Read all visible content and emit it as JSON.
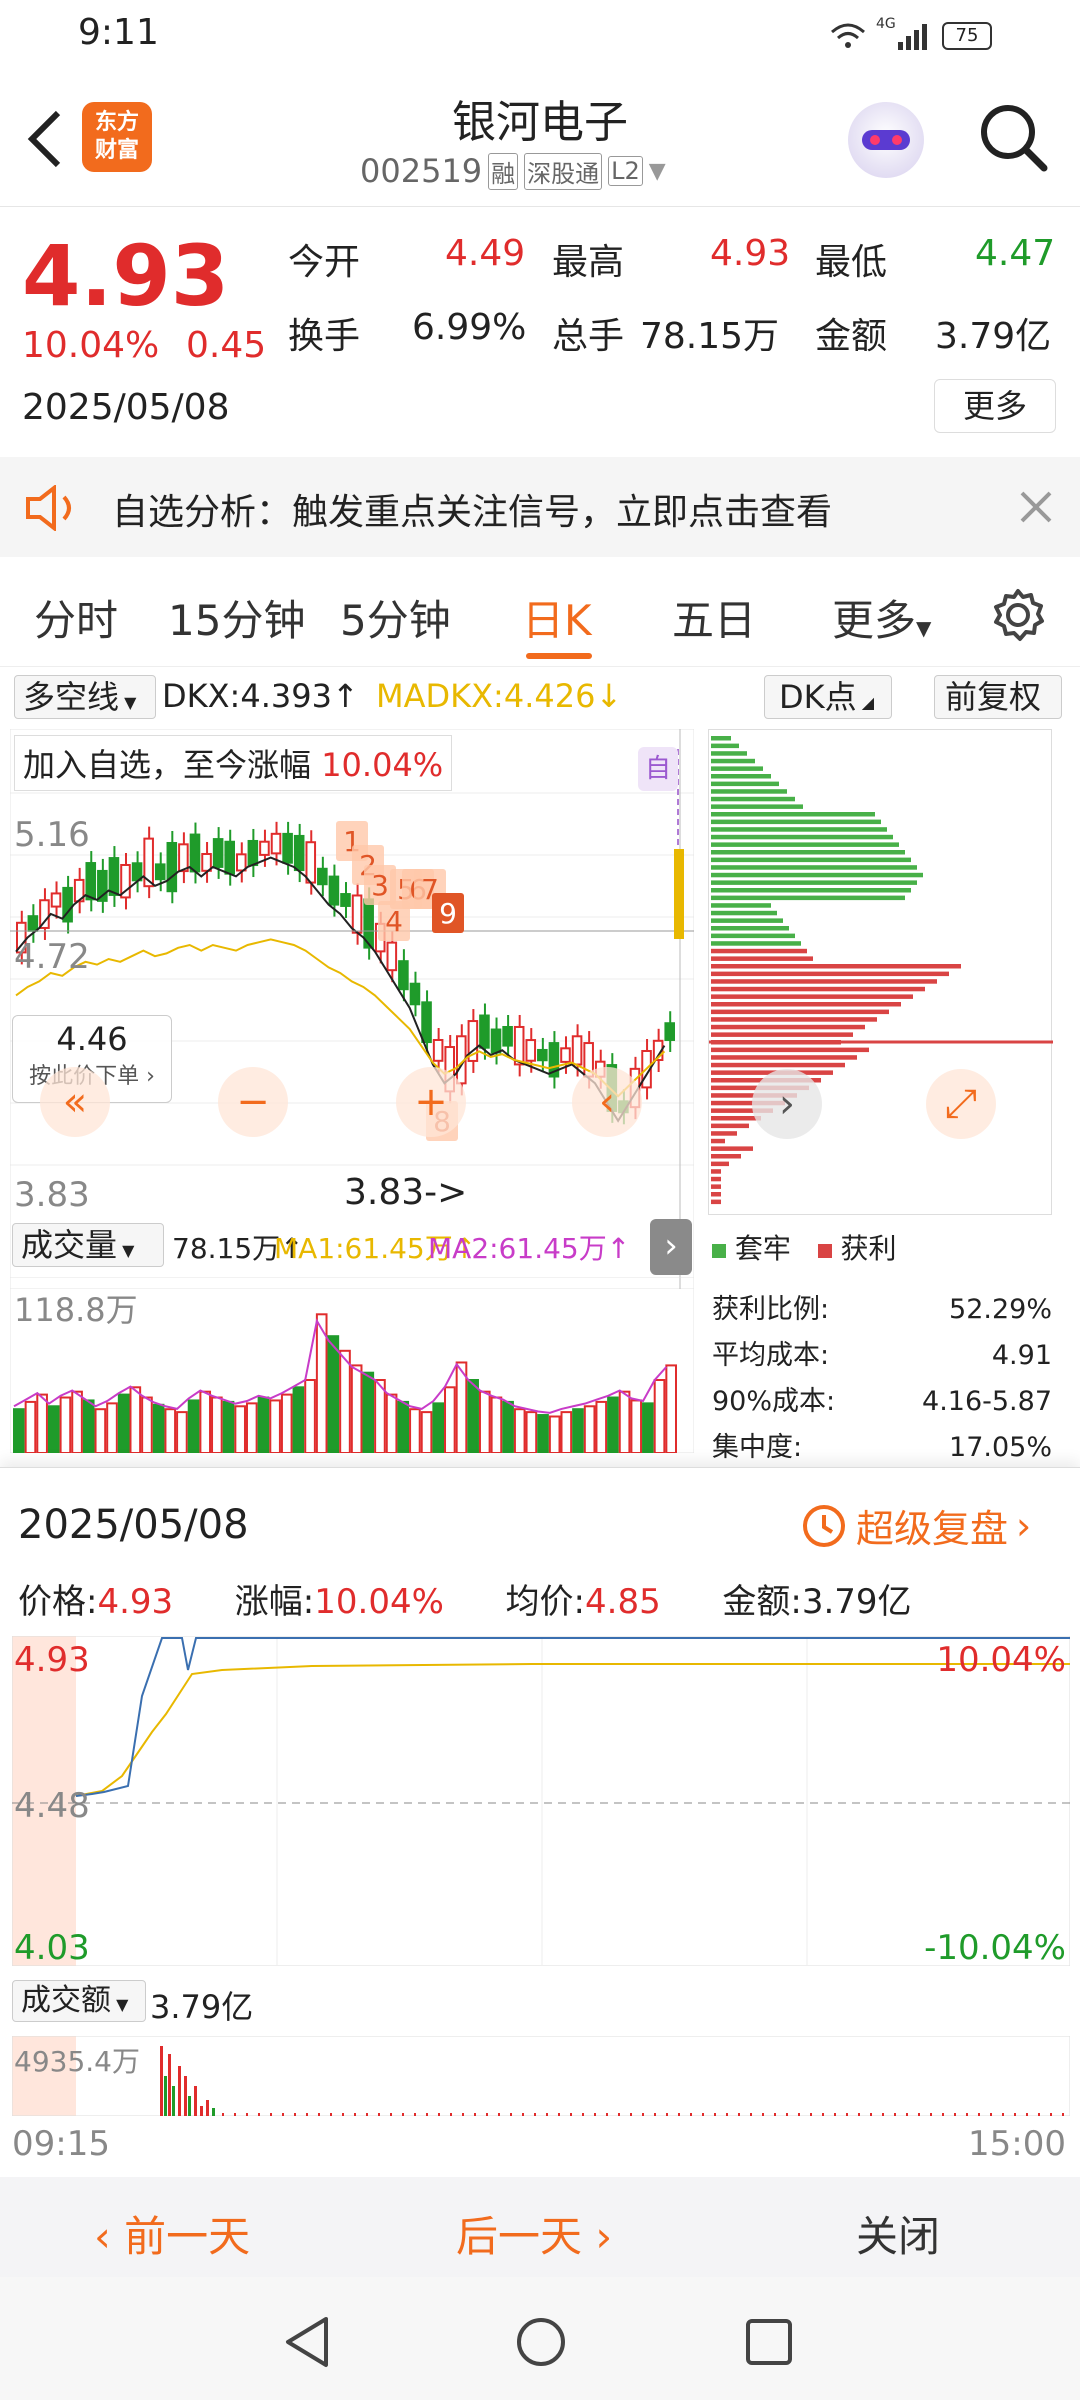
{
  "status_bar": {
    "time": "9:11",
    "signal_label": "4G",
    "battery": "75"
  },
  "header": {
    "back_icon": "chevron-left-icon",
    "logo_text_line1": "东方",
    "logo_text_line2": "财富",
    "stock_name": "银河电子",
    "stock_code": "002519",
    "tags": [
      "融",
      "深股通",
      "L2"
    ],
    "avatar_icon": "robot-avatar-icon",
    "search_icon": "search-icon"
  },
  "quote": {
    "price": "4.93",
    "change_pct": "10.04%",
    "change_amt": "0.45",
    "date": "2025/05/08",
    "open_label": "今开",
    "open_val": "4.49",
    "high_label": "最高",
    "high_val": "4.93",
    "low_label": "最低",
    "low_val": "4.47",
    "turnover_label": "换手",
    "turnover_val": "6.99%",
    "volume_label": "总手",
    "volume_val": "78.15万",
    "amount_label": "金额",
    "amount_val": "3.79亿",
    "more_button": "更多"
  },
  "notice": {
    "text": "自选分析：触发重点关注信号，立即点击查看"
  },
  "tabs": {
    "items": [
      "分时",
      "15分钟",
      "5分钟",
      "日K",
      "五日",
      "更多"
    ],
    "active": "日K"
  },
  "kchart": {
    "indicator_select": "多空线",
    "dkx_label": "DKX:4.393↑",
    "madkx_label": "MADKX:4.426↓",
    "dk_button": "DK点",
    "fq_button": "前复权",
    "added_text": "加入自选，至今涨幅",
    "added_pct": "10.04%",
    "price_labels": [
      "5.16",
      "4.72",
      "3.83"
    ],
    "cursor_price": "4.46",
    "cursor_order_text": "按此价下单",
    "low_marker": "3.83->",
    "signal_numbers": [
      "1",
      "2",
      "3",
      "4",
      "5",
      "6",
      "7",
      "8",
      "9"
    ],
    "self_tag": "自",
    "legend_trapped": "套牢",
    "legend_profit": "获利",
    "chips": {
      "profit_ratio_label": "获利比例:",
      "profit_ratio": "52.29%",
      "avg_cost_label": "平均成本:",
      "avg_cost": "4.91",
      "cost90_label": "90%成本:",
      "cost90": "4.16-5.87",
      "concentration_label": "集中度:",
      "concentration": "17.05%"
    },
    "volume_select": "成交量",
    "volume_val": "78.15万↑",
    "ma1": "MA1:61.45万↑",
    "ma2": "MA2:61.45万↑",
    "volume_max": "118.8万"
  },
  "popup": {
    "date": "2025/05/08",
    "replay_text": "超级复盘",
    "price_label": "价格:",
    "price_val": "4.93",
    "pct_label": "涨幅:",
    "pct_val": "10.04%",
    "avg_label": "均价:",
    "avg_val": "4.85",
    "amount_label": "金额:",
    "amount_val": "3.79亿",
    "y_top": "4.93",
    "y_mid": "4.48",
    "y_bottom": "4.03",
    "pct_top": "10.04%",
    "pct_bottom": "-10.04%",
    "amount_select": "成交额",
    "amount_total": "3.79亿",
    "amount_max": "4935.4万",
    "time_start": "09:15",
    "time_end": "15:00"
  },
  "bottom": {
    "prev_day": "前一天",
    "next_day": "后一天",
    "close": "关闭"
  },
  "colors": {
    "up": "#e02c2c",
    "down": "#1f9b2a",
    "accent": "#f26b1d",
    "ma_yellow": "#e8b800",
    "ma_purple": "#c83cc8",
    "price_line": "#3a6fb0"
  }
}
